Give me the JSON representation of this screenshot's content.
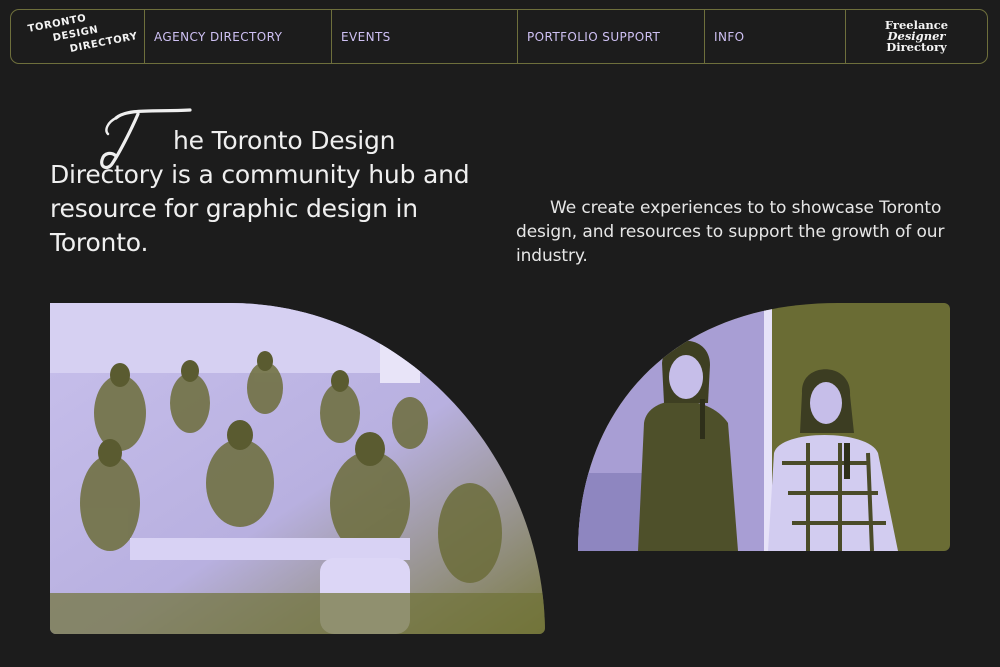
{
  "nav": {
    "logo_lines": [
      "TORONTO",
      "DESIGN",
      "DIRECTORY"
    ],
    "links": [
      "AGENCY DIRECTORY",
      "EVENTS",
      "PORTFOLIO SUPPORT",
      "INFO"
    ],
    "partner_lines": [
      "Freelance",
      "Designer",
      "Directory"
    ]
  },
  "hero": {
    "dropcap": "T",
    "headline_rest": "he Toronto Design Directory is a community hub and resource for graphic design in Toronto.",
    "subtext": "We create experiences to to showcase Toronto design, and resources to support the growth of our industry."
  },
  "colors": {
    "background": "#1c1c1c",
    "accent_lavender": "#cfc1f4",
    "accent_olive": "#6f7236",
    "border_olive": "#6e6f3c"
  }
}
